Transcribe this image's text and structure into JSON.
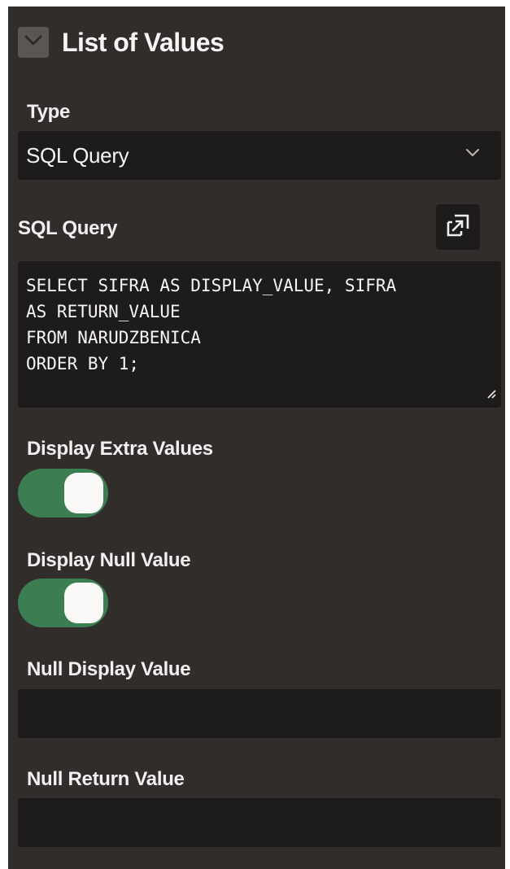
{
  "section": {
    "title": "List of Values",
    "collapse_icon": "chevron-down-icon"
  },
  "type_field": {
    "label": "Type",
    "value": "SQL Query",
    "icon": "chevron-down-icon"
  },
  "sql_query": {
    "label": "SQL Query",
    "expand_icon": "expand-icon",
    "lines": [
      "SELECT SIFRA AS DISPLAY_VALUE, SIFRA",
      "AS RETURN_VALUE",
      "FROM NARUDZBENICA",
      "ORDER BY 1;"
    ]
  },
  "display_extra_values": {
    "label": "Display Extra Values",
    "state": "on"
  },
  "display_null_value": {
    "label": "Display Null Value",
    "state": "on"
  },
  "null_display_value": {
    "label": "Null Display Value",
    "value": ""
  },
  "null_return_value": {
    "label": "Null Return Value",
    "value": ""
  },
  "colors": {
    "panel_bg": "#312d2a",
    "field_bg": "#1e1c1a",
    "toggle_on": "#3c7d52",
    "text": "#f7f6f4"
  }
}
